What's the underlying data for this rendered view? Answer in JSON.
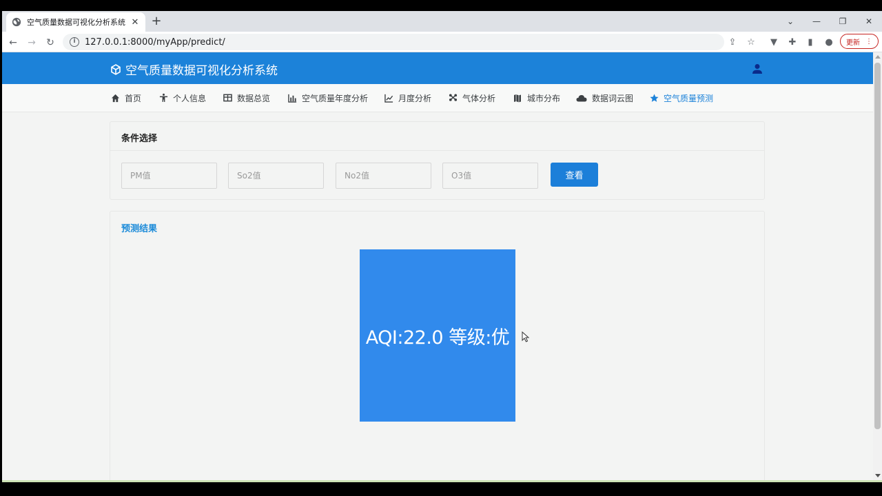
{
  "browser": {
    "tab_title": "空气质量数据可视化分析系统",
    "url": "127.0.0.1:8000/myApp/predict/",
    "update_label": "更新"
  },
  "header": {
    "app_name": "空气质量数据可视化分析系统"
  },
  "menu": {
    "items": [
      {
        "label": "首页",
        "icon": "home-icon"
      },
      {
        "label": "个人信息",
        "icon": "person-icon"
      },
      {
        "label": "数据总览",
        "icon": "table-icon"
      },
      {
        "label": "空气质量年度分析",
        "icon": "bar-chart-icon"
      },
      {
        "label": "月度分析",
        "icon": "line-chart-icon"
      },
      {
        "label": "气体分析",
        "icon": "molecule-icon"
      },
      {
        "label": "城市分布",
        "icon": "map-icon"
      },
      {
        "label": "数据词云图",
        "icon": "cloud-icon"
      },
      {
        "label": "空气质量预测",
        "icon": "star-icon",
        "active": true
      }
    ]
  },
  "conditions": {
    "title": "条件选择",
    "pm_placeholder": "PM值",
    "so2_placeholder": "So2值",
    "no2_placeholder": "No2值",
    "o3_placeholder": "O3值",
    "query_label": "查看"
  },
  "result": {
    "title": "预测结果",
    "text": "AQI:22.0 等级:优"
  },
  "colors": {
    "header": "#1c82d9",
    "result_box": "#318aec",
    "active_menu": "#1c82d9"
  }
}
